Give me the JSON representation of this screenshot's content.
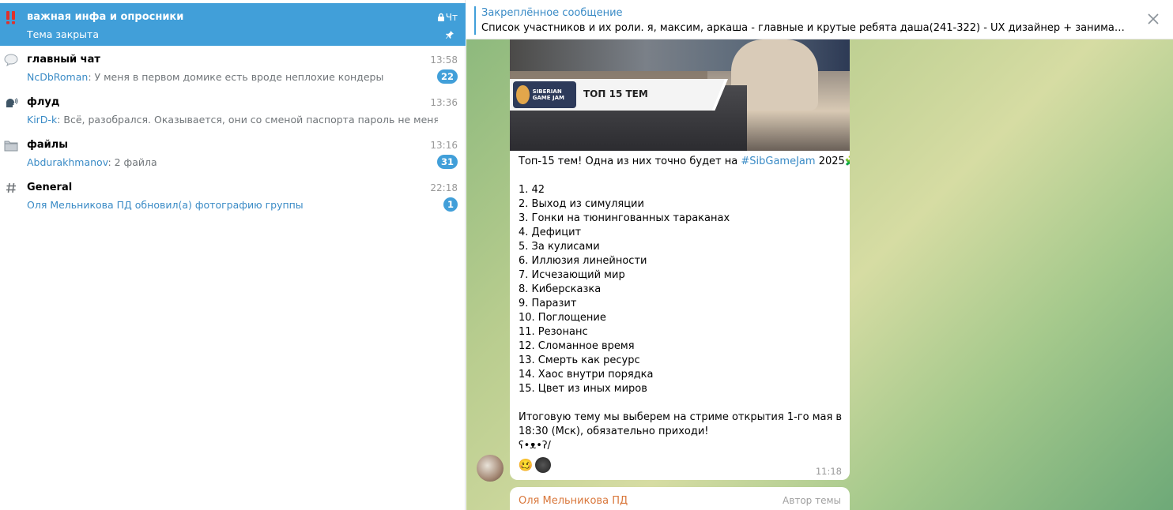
{
  "sidebar": {
    "topics": [
      {
        "name": "важная инфа и опросники",
        "time": "Чт",
        "preview_sender": "",
        "preview_text": "Тема закрыта",
        "unread": "",
        "icon": "double-exclamation-icon",
        "active": true,
        "locked": true,
        "pinned": true
      },
      {
        "name": "главный чат",
        "time": "13:58",
        "preview_sender": "NcDbRoman",
        "preview_text": ": У меня в первом домике есть вроде неплохие кондеры",
        "unread": "22",
        "icon": "speech-bubble-icon"
      },
      {
        "name": "флуд",
        "time": "13:36",
        "preview_sender": "KirD-k",
        "preview_text": ": Всё, разобрался. Оказывается, они со сменой паспорта пароль не меняют",
        "unread": "",
        "icon": "speaking-head-icon"
      },
      {
        "name": "файлы",
        "time": "13:16",
        "preview_sender": "Abdurakhmanov",
        "preview_text": ": 2 файла",
        "unread": "31",
        "icon": "folder-icon"
      },
      {
        "name": "General",
        "time": "22:18",
        "preview_sender": "Оля Мельникова ПД обновил(а) фотографию группы",
        "preview_text": "",
        "unread": "1",
        "icon": "hash-icon"
      }
    ]
  },
  "pinned": {
    "title": "Закреплённое сообщение",
    "text": "Список участников и их роли.  я, максим, аркаша - главные и крутые ребята  даша(241-322) - UX дизайнер + занимается звуком да..."
  },
  "message": {
    "image_logo_text": "SIBERIAN GAME JAM",
    "image_banner_title": "ТОП 15 ТЕМ",
    "intro_before": "Топ-15 тем! Одна из них точно будет на ",
    "intro_hashtag": "#SibGameJam",
    "intro_after": " 2025🧩",
    "items": [
      "1. 42",
      "2. Выход из симуляции",
      "3. Гонки на тюнингованных тараканах",
      "4. Дефицит",
      "5. За кулисами",
      "6. Иллюзия линейности",
      "7. Исчезающий мир",
      "8. Киберсказка",
      "9. Паразит",
      "10. Поглощение",
      "11. Резонанс",
      "12. Сломанное время",
      "13. Смерть как ресурс",
      "14. Хаос внутри порядка",
      "15. Цвет из иных миров"
    ],
    "outro": "Итоговую тему мы выберем на стриме открытия 1-го мая в 18:30 (Мск), обязательно приходи!",
    "kaomoji": "ʕ•ᴥ•ʔ/",
    "reaction_emoji": "🥴",
    "time": "11:18"
  },
  "next_message": {
    "author": "Оля Мельникова ПД",
    "role": "Автор темы"
  },
  "colors": {
    "accent": "#419fd9",
    "link": "#3a8bc6",
    "author_orange": "#d9773b"
  }
}
